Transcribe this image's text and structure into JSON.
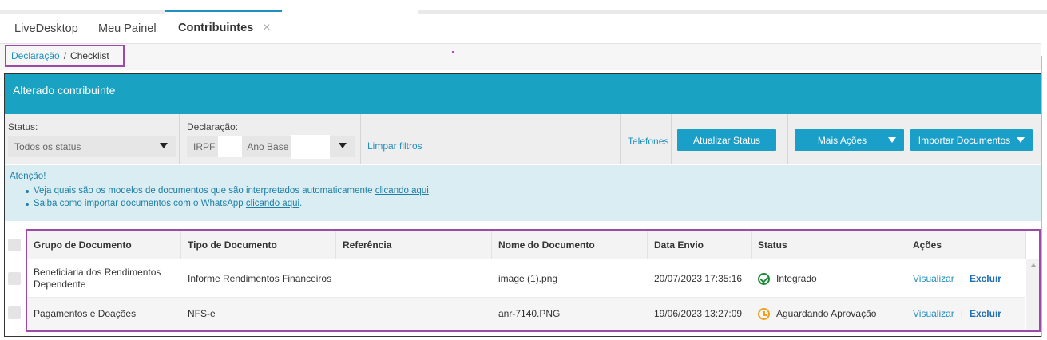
{
  "tabs": [
    {
      "label": "LiveDesktop"
    },
    {
      "label": "Meu Painel"
    },
    {
      "label": "Contribuintes",
      "active": true,
      "close": "×"
    }
  ],
  "breadcrumb": {
    "link": "Declaração",
    "separator": "/",
    "current": "Checklist"
  },
  "banner": {
    "title": "Alterado contribuinte",
    "color": "#19a2c1"
  },
  "filters": {
    "status_label": "Status:",
    "status_value": "Todos os status",
    "declaracao_label": "Declaração:",
    "declaracao_prefix": "IRPF",
    "declaracao_mid": "Ano Base",
    "limpar": "Limpar filtros",
    "telefones": "Telefones",
    "atualizar": "Atualizar Status",
    "mais_acoes": "Mais Ações",
    "importar": "Importar Documentos"
  },
  "attention": {
    "title": "Atenção!",
    "items": [
      {
        "text": "Veja quais são os modelos de documentos que são interpretados automaticamente ",
        "link": "clicando aqui",
        "tail": "."
      },
      {
        "text": "Saiba como importar documentos com o WhatsApp ",
        "link": "clicando aqui",
        "tail": "."
      }
    ]
  },
  "table": {
    "headers": [
      "Grupo de Documento",
      "Tipo de Documento",
      "Referência",
      "Nome do Documento",
      "Data Envio",
      "Status",
      "Ações"
    ],
    "rows": [
      {
        "grupo_line1": "Beneficiaria dos Rendimentos",
        "grupo_line2": "Dependente",
        "tipo": "Informe Rendimentos Financeiros",
        "referencia": "",
        "nome": "image (1).png",
        "data": "20/07/2023 17:35:16",
        "status": "Integrado",
        "status_icon": "check-circle-icon",
        "visualizar": "Visualizar",
        "sep": "|",
        "excluir": "Excluir"
      },
      {
        "grupo_line1": "Pagamentos e Doações",
        "grupo_line2": "",
        "tipo": "NFS-e",
        "referencia": "",
        "nome": "anr-7140.PNG",
        "data": "19/06/2023 13:27:09",
        "status": "Aguardando Aprovação",
        "status_icon": "clock-icon",
        "visualizar": "Visualizar",
        "sep": "|",
        "excluir": "Excluir"
      }
    ]
  }
}
